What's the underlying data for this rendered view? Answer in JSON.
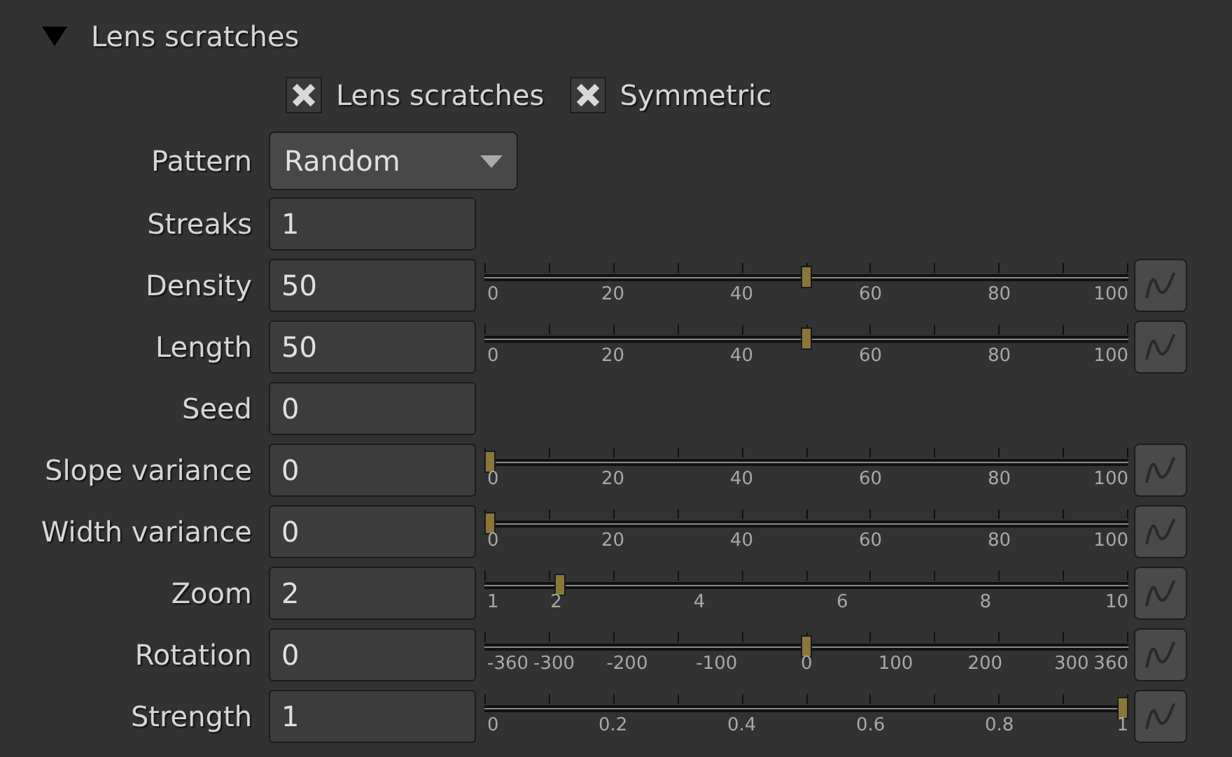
{
  "section": {
    "title": "Lens scratches",
    "expanded": true
  },
  "checkboxes": [
    {
      "label": "Lens scratches",
      "checked": true
    },
    {
      "label": "Symmetric",
      "checked": true
    }
  ],
  "pattern": {
    "label": "Pattern",
    "value": "Random"
  },
  "params": [
    {
      "kind": "text",
      "label": "Streaks",
      "value": "1"
    },
    {
      "kind": "slider",
      "label": "Density",
      "value": "50",
      "level": 0.5,
      "ticks": [
        "0",
        "20",
        "40",
        "60",
        "80",
        "100"
      ]
    },
    {
      "kind": "slider",
      "label": "Length",
      "value": "50",
      "level": 0.5,
      "ticks": [
        "0",
        "20",
        "40",
        "60",
        "80",
        "100"
      ]
    },
    {
      "kind": "text",
      "label": "Seed",
      "value": "0"
    },
    {
      "kind": "slider",
      "label": "Slope variance",
      "value": "0",
      "level": 0,
      "ticks": [
        "0",
        "20",
        "40",
        "60",
        "80",
        "100"
      ]
    },
    {
      "kind": "slider",
      "label": "Width variance",
      "value": "0",
      "level": 0,
      "ticks": [
        "0",
        "20",
        "40",
        "60",
        "80",
        "100"
      ]
    },
    {
      "kind": "slider",
      "label": "Zoom",
      "value": "2",
      "level": 0.111,
      "ticks": [
        "1",
        "2",
        "4",
        "6",
        "8",
        "10"
      ]
    },
    {
      "kind": "slider",
      "label": "Rotation",
      "value": "0",
      "level": 0.5,
      "ticks": [
        "-360",
        "-300",
        "-200",
        "-100",
        "0",
        "100",
        "200",
        "300",
        "360"
      ]
    },
    {
      "kind": "slider",
      "label": "Strength",
      "value": "1",
      "level": 1,
      "ticks": [
        "0",
        "0.2",
        "0.4",
        "0.6",
        "0.8",
        "1"
      ]
    }
  ]
}
